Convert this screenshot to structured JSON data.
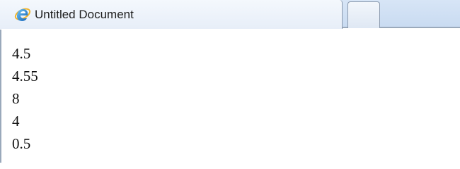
{
  "tab": {
    "title": "Untitled Document",
    "icon": "internet-explorer-icon"
  },
  "new_tab": {
    "icon": "new-tab-button"
  },
  "document": {
    "lines": [
      "4.5",
      "4.55",
      "8",
      "4",
      "0.5"
    ]
  },
  "colors": {
    "tab_bar": "#c9dbf1",
    "active_tab": "#eef3fa",
    "page_background": "#ffffff"
  }
}
